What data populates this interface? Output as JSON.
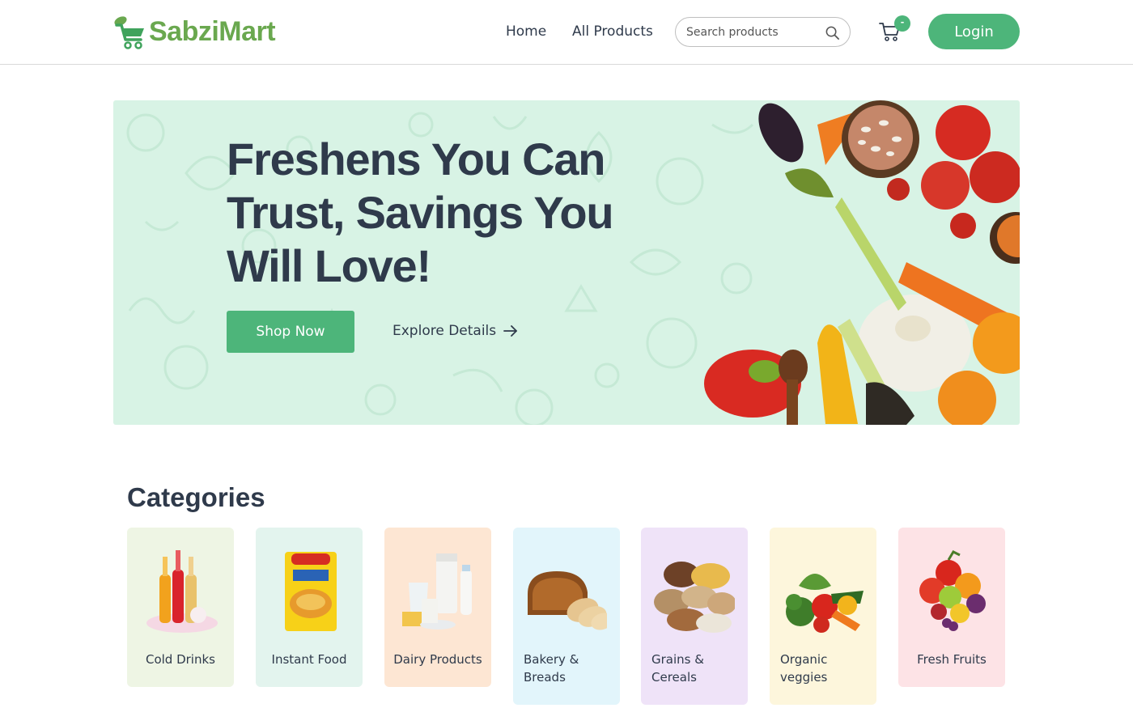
{
  "header": {
    "brand": "SabziMart",
    "nav": [
      {
        "label": "Home"
      },
      {
        "label": "All Products"
      }
    ],
    "search": {
      "placeholder": "Search products",
      "value": ""
    },
    "cart_badge": "-",
    "login_label": "Login"
  },
  "hero": {
    "title": "Freshens You Can Trust, Savings You Will Love!",
    "primary_cta": "Shop Now",
    "secondary_cta": "Explore Details",
    "background_color": "#d8f3e5"
  },
  "categories": {
    "title": "Categories",
    "items": [
      {
        "label": "Cold Drinks",
        "color": "#eef5e4",
        "icon": "cold-drinks-icon"
      },
      {
        "label": "Instant Food",
        "color": "#e3f4ee",
        "icon": "instant-food-icon"
      },
      {
        "label": "Dairy Products",
        "color": "#fde6d3",
        "icon": "dairy-icon"
      },
      {
        "label": "Bakery & Breads",
        "color": "#e2f5fb",
        "icon": "bread-icon"
      },
      {
        "label": "Grains & Cereals",
        "color": "#efe3f8",
        "icon": "grains-icon"
      },
      {
        "label": "Organic veggies",
        "color": "#fdf6dc",
        "icon": "veggies-icon"
      },
      {
        "label": "Fresh Fruits",
        "color": "#fde3e6",
        "icon": "fruits-icon"
      }
    ]
  },
  "colors": {
    "accent": "#4db57a",
    "text": "#2f3a4b",
    "brand_light": "#6aa84f"
  }
}
